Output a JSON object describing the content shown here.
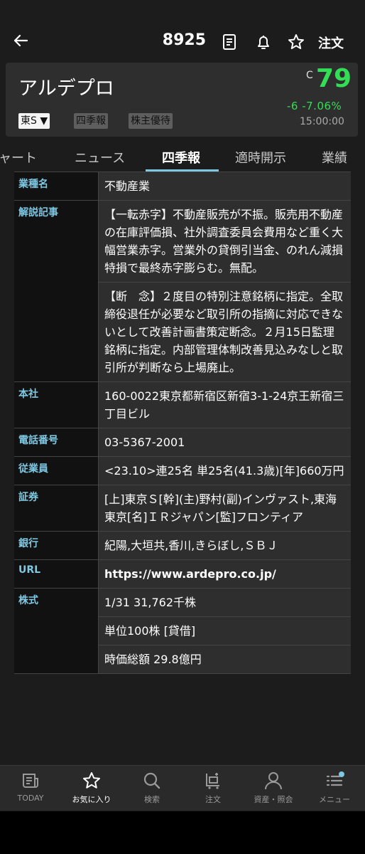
{
  "header": {
    "code": "8925",
    "order_label": "注文"
  },
  "stock": {
    "name": "アルデプロ",
    "price_prefix": "C",
    "price": "79",
    "change": "-6  -7.06%",
    "time": "15:00:00",
    "market_select": "東S ▼",
    "tags": [
      "四季報",
      "株主優待"
    ]
  },
  "tabs": [
    {
      "label": "ャート"
    },
    {
      "label": "ニュース"
    },
    {
      "label": "四季報"
    },
    {
      "label": "適時開示"
    },
    {
      "label": "業績"
    }
  ],
  "table": {
    "rows": [
      {
        "label": "業種名",
        "cells": [
          "不動産業"
        ]
      },
      {
        "label": "解説記事",
        "cells": [
          "【一転赤字】不動産販売が不振。販売用不動産の在庫評価損、社外調査委員会費用など重く大幅営業赤字。営業外の貸倒引当金、のれん減損特損で最終赤字膨らむ。無配。",
          "【断　念】２度目の特別注意銘柄に指定。全取締役退任が必要など取引所の指摘に対応できないとして改善計画書策定断念。２月15日監理銘柄に指定。内部管理体制改善見込みなしと取引所が判断なら上場廃止。"
        ]
      },
      {
        "label": "本社",
        "cells": [
          "160-0022東京都新宿区新宿3-1-24京王新宿三丁目ビル"
        ]
      },
      {
        "label": "電話番号",
        "cells": [
          "03-5367-2001"
        ]
      },
      {
        "label": "従業員",
        "cells": [
          "<23.10>連25名 単25名(41.3歳)[年]660万円"
        ]
      },
      {
        "label": "証券",
        "cells": [
          "[上]東京Ｓ[幹](主)野村(副)インヴァスト,東海東京[名]ＩＲジャパン[監]フロンティア"
        ]
      },
      {
        "label": "銀行",
        "cells": [
          "紀陽,大垣共,香川,きらぼし,ＳＢＪ"
        ]
      },
      {
        "label": "URL",
        "cells": [
          "https://www.ardepro.co.jp/"
        ]
      },
      {
        "label": "株式",
        "cells": [
          "1/31 31,762千株",
          "単位100株 [貸借]",
          "時価総額 29.8億円"
        ]
      }
    ]
  },
  "bottom_nav": [
    {
      "label": "TODAY"
    },
    {
      "label": "お気に入り"
    },
    {
      "label": "検索"
    },
    {
      "label": "注文"
    },
    {
      "label": "資産・照会"
    },
    {
      "label": "メニュー"
    }
  ],
  "colors": {
    "price_green": "#33dd55",
    "label_blue": "#7ec8e3",
    "background": "#1c1c1c"
  }
}
